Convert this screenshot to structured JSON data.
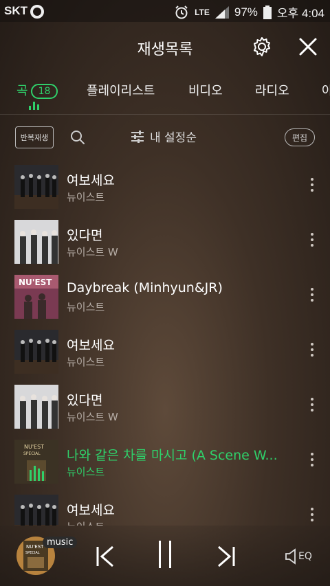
{
  "status": {
    "carrier": "SKT",
    "network": "LTE",
    "battery": "97%",
    "time": "오후 4:04"
  },
  "header": {
    "title": "재생목록"
  },
  "tabs": [
    {
      "label": "곡",
      "badge": "18",
      "active": true
    },
    {
      "label": "플레이리스트"
    },
    {
      "label": "비디오"
    },
    {
      "label": "라디오"
    },
    {
      "label": "아"
    }
  ],
  "toolbar": {
    "repeat_label": "반복재생",
    "sort_label": "내 설정순",
    "edit_label": "편집"
  },
  "tracks": [
    {
      "title": "여보세요",
      "artist": "뉴이스트",
      "art": "dark-group"
    },
    {
      "title": "있다면",
      "artist": "뉴이스트 W",
      "art": "light-group"
    },
    {
      "title": "Daybreak (Minhyun&JR)",
      "artist": "뉴이스트",
      "art": "pink-nuest"
    },
    {
      "title": "여보세요",
      "artist": "뉴이스트",
      "art": "dark-group"
    },
    {
      "title": "있다면",
      "artist": "뉴이스트 W",
      "art": "light-group"
    },
    {
      "title": "나와 같은 차를 마시고 (A Scene W...",
      "artist": "뉴이스트",
      "art": "green-special",
      "playing": true
    },
    {
      "title": "여보세요",
      "artist": "뉴이스트",
      "art": "dark-group"
    }
  ],
  "player": {
    "service_tag": "music",
    "eq_label": "EQ"
  },
  "colors": {
    "accent": "#2fd06a"
  }
}
